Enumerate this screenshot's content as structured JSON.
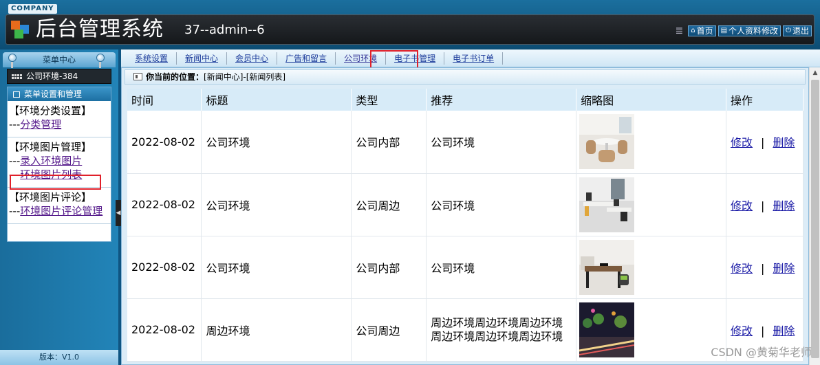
{
  "header": {
    "company": "COMPANY",
    "title": "后台管理系统",
    "user_info": "37--admin--6",
    "links": [
      {
        "label": "首页",
        "icon": "home-icon"
      },
      {
        "label": "个人资料修改",
        "icon": "profile-icon"
      },
      {
        "label": "退出",
        "icon": "power-icon"
      }
    ]
  },
  "sidebar": {
    "menu_center": "菜单中心",
    "current": "公司环境-384",
    "box_title": "菜单设置和管理",
    "groups": [
      {
        "title": "【环境分类设置】",
        "items": [
          {
            "prefix": "---",
            "label": "分类管理"
          }
        ]
      },
      {
        "title": "【环境图片管理】",
        "items": [
          {
            "prefix": "---",
            "label": "录入环境图片"
          },
          {
            "prefix": "---",
            "label": "环境图片列表"
          }
        ]
      },
      {
        "title": "【环境图片评论】",
        "items": [
          {
            "prefix": "---",
            "label": "环境图片评论管理"
          }
        ]
      }
    ],
    "version": "版本：V1.0"
  },
  "topnav": {
    "items": [
      "系统设置",
      "新闻中心",
      "会员中心",
      "广告和留言",
      "公司环境",
      "电子书管理",
      "电子书订单"
    ],
    "active_index": 4
  },
  "main": {
    "position_label": "你当前的位置：",
    "position_path": "[新闻中心]-[新闻列表]",
    "columns": [
      "时间",
      "标题",
      "类型",
      "推荐",
      "缩略图",
      "操作"
    ],
    "rows": [
      {
        "time": "2022-08-02",
        "title": "公司环境",
        "type": "公司内部",
        "recommend": "公司环境",
        "edit": "修改",
        "sep": "|",
        "delete": "删除"
      },
      {
        "time": "2022-08-02",
        "title": "公司环境",
        "type": "公司周边",
        "recommend": "公司环境",
        "edit": "修改",
        "sep": "|",
        "delete": "删除"
      },
      {
        "time": "2022-08-02",
        "title": "公司环境",
        "type": "公司内部",
        "recommend": "公司环境",
        "edit": "修改",
        "sep": "|",
        "delete": "删除"
      },
      {
        "time": "2022-08-02",
        "title": "周边环境",
        "type": "公司周边",
        "recommend": "周边环境周边环境周边环境周边环境周边环境周边环境",
        "edit": "修改",
        "sep": "|",
        "delete": "删除"
      }
    ]
  },
  "watermark": "CSDN @黄菊华老师",
  "colors": {
    "accent": "#1b6f9e",
    "highlight": "#e0202a",
    "link": "#551a8b"
  }
}
